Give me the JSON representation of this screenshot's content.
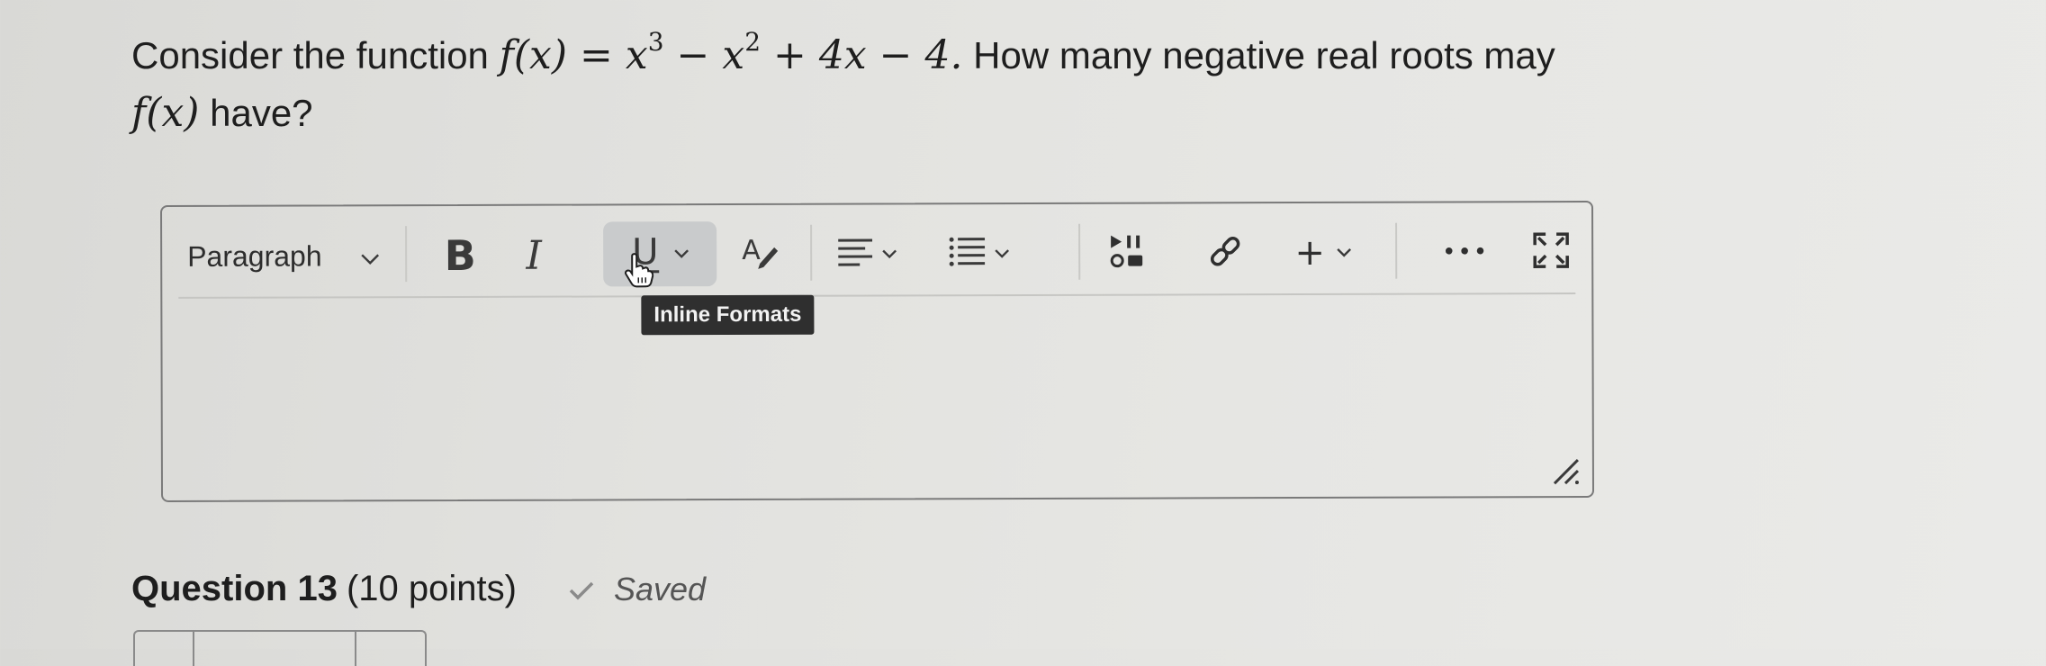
{
  "question": {
    "prefix": "Consider the function ",
    "function_name": "f(x)",
    "equals": " = ",
    "term1": "x",
    "term1_exp": "3",
    "op1": " − ",
    "term2": "x",
    "term2_exp": "2",
    "rest": " + 4x − 4.",
    "middle": " How many negative real roots may ",
    "function_name_2": "f(x)",
    "suffix": " have?"
  },
  "toolbar": {
    "paragraph_label": "Paragraph",
    "bold_label": "B",
    "italic_label": "I",
    "underline_label": "U",
    "textcolor_label": "A",
    "insert_label": "+",
    "more_label": "•••",
    "tooltip": "Inline Formats"
  },
  "next_question": {
    "title": "Question 13",
    "points": "(10 points)",
    "status": "Saved"
  },
  "colors": {
    "tooltip_bg": "#2f2f2f",
    "active_button_bg": "#c9cbcc"
  }
}
